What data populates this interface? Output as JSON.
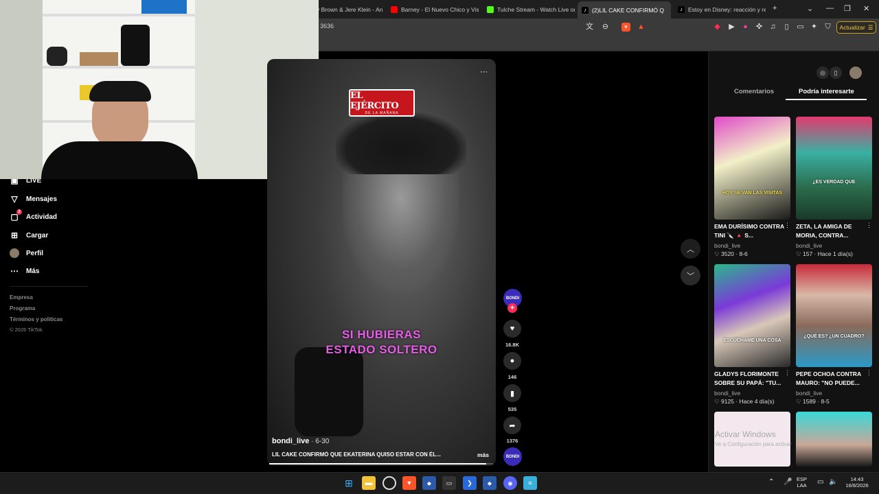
{
  "browser": {
    "tabs": [
      {
        "label": "y Brown & Jere Klein - An",
        "icon": "tab-favicon",
        "active": false
      },
      {
        "label": "Barney - El Nuevo Chico y Vis",
        "icon": "youtube-icon",
        "active": false
      },
      {
        "label": "Tulche Stream - Watch Live on",
        "icon": "kick-icon",
        "active": false
      },
      {
        "label": "(2)LIL CAKE CONFIRMÓ Q",
        "icon": "tiktok-icon",
        "active": true
      },
      {
        "label": "Estoy en Disney: reacción y re",
        "icon": "tiktok-icon",
        "active": false
      }
    ],
    "url_fragment": "3636",
    "update_label": "Actualizar"
  },
  "sidebar": {
    "items": [
      {
        "label": "LIVE",
        "icon": "live-icon"
      },
      {
        "label": "Mensajes",
        "icon": "messages-icon"
      },
      {
        "label": "Actividad",
        "icon": "activity-icon",
        "badge": "2"
      },
      {
        "label": "Cargar",
        "icon": "upload-icon"
      },
      {
        "label": "Perfil",
        "icon": "profile-avatar"
      },
      {
        "label": "Más",
        "icon": "more-icon"
      }
    ],
    "footer": [
      "Empresa",
      "Programa",
      "Términos y políticas",
      "© 2026 TikTok"
    ]
  },
  "video": {
    "logo_line1": "EL EJÉRCITO",
    "logo_line2": "DE LA MAÑANA",
    "caption_line1": "SI HUBIERAS",
    "caption_line2": "ESTADO SOLTERO",
    "author": "bondi_live",
    "date": " · 6-30",
    "description": "LIL CAKE CONFIRMÓ QUE EKATERINA QUISO ESTAR CON ÉL...",
    "more_label": "más",
    "progress": 0.97
  },
  "actions": {
    "avatar_text": "BONDI",
    "follow_symbol": "+",
    "likes": "16.8K",
    "comments": "146",
    "saves": "535",
    "shares": "1376"
  },
  "right_panel": {
    "tabs": [
      "Comentarios",
      "Podría interesarte"
    ],
    "active_tab": 1,
    "cards": [
      {
        "title": "EMA DURÍSIMO CONTRA TINI 🔪 🔺 S...",
        "author": "bondi_live",
        "likes": "3520",
        "when": "8-6",
        "thumb_caption": "HOY SE VAN LAS VISITAS"
      },
      {
        "title": "ZETA, LA AMIGA DE MORIA, CONTRA...",
        "author": "bondi_live",
        "likes": "157",
        "when": "Hace 1 día(s)",
        "thumb_caption": "¿ES VERDAD QUE"
      },
      {
        "title": "GLADYS FLORIMONTE SOBRE SU PAPÁ: \"TU...",
        "author": "bondi_live",
        "likes": "9125",
        "when": "Hace 4 día(s)",
        "thumb_caption": "ESCÚCHAME UNA COSA"
      },
      {
        "title": "PEPE OCHOA CONTRA MAURO: \"NO PUEDE...",
        "author": "bondi_live",
        "likes": "1589",
        "when": "8-5",
        "thumb_caption": "¿QUÉ ES? ¿UN CUADRO?"
      }
    ],
    "watermark_title": "Activar Windows",
    "watermark_sub": "Ve a Configuración para activar"
  },
  "taskbar": {
    "lang_line1": "ESP",
    "lang_line2": "LAA",
    "time": "14:43",
    "date": "16/8/2026"
  }
}
